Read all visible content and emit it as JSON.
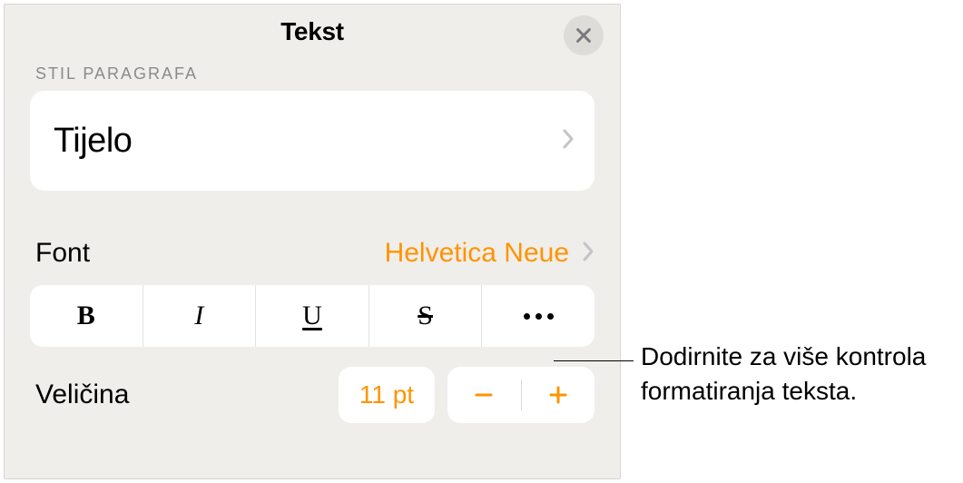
{
  "panel": {
    "title": "Tekst",
    "section_label": "STIL PARAGRAFA",
    "paragraph_style": "Tijelo",
    "font_label": "Font",
    "font_value": "Helvetica Neue",
    "glyphs": {
      "bold": "B",
      "italic": "I",
      "underline": "U",
      "strike": "S"
    },
    "size_label": "Veličina",
    "size_value": "11 pt"
  },
  "callout": {
    "text_line1": "Dodirnite za više kontrola",
    "text_line2": "formatiranja teksta."
  },
  "colors": {
    "accent": "#fe9400"
  }
}
